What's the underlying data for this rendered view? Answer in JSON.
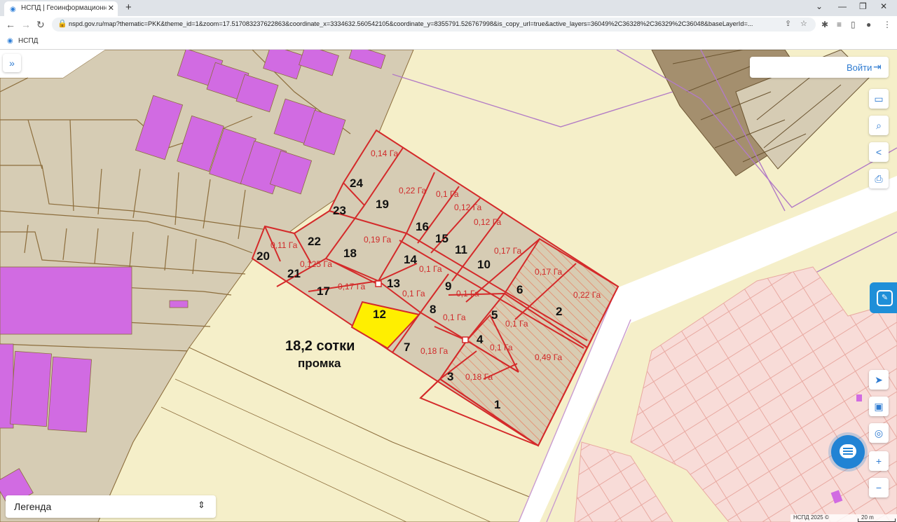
{
  "browser": {
    "tab_title": "НСПД | Геоинформационный п",
    "tab_close": "✕",
    "new_tab": "+",
    "url": "nspd.gov.ru/map?thematic=PKK&theme_id=1&zoom=17.517083237622863&coordinate_x=3334632.560542105&coordinate_y=8355791.526767998&is_copy_url=true&active_layers=36049%2C36328%2C36329%2C36048&baseLayerId=...",
    "bookmark": "НСПД"
  },
  "map": {
    "login_label": "Войти",
    "legend_label": "Легенда",
    "attribution": "НСПД 2025 ©",
    "scale_label": "20 m",
    "lot_title": "18,2 сотки",
    "lot_subtitle": "промка",
    "parcels": [
      {
        "id": "1",
        "area": "0,49 Га"
      },
      {
        "id": "2",
        "area": "0,22 Га"
      },
      {
        "id": "3",
        "area": "0,18 Га"
      },
      {
        "id": "4",
        "area": "0,1 Га"
      },
      {
        "id": "5",
        "area": "0,1 Га"
      },
      {
        "id": "6",
        "area": "0,17 Га"
      },
      {
        "id": "7",
        "area": "0,18 Га"
      },
      {
        "id": "8",
        "area": "0,1 Га"
      },
      {
        "id": "9",
        "area": "0,1 Га"
      },
      {
        "id": "10",
        "area": "0,17 Га"
      },
      {
        "id": "11",
        "area": "0,12 Га"
      },
      {
        "id": "12",
        "area": ""
      },
      {
        "id": "13",
        "area": "0,1 Га"
      },
      {
        "id": "14",
        "area": "0,1 Га"
      },
      {
        "id": "15",
        "area": "0,12 Га"
      },
      {
        "id": "16",
        "area": "0,1 Га"
      },
      {
        "id": "17",
        "area": "0,17 Га"
      },
      {
        "id": "18",
        "area": "0,19 Га"
      },
      {
        "id": "19",
        "area": "0,22 Га"
      },
      {
        "id": "20",
        "area": "0,11 Га"
      },
      {
        "id": "21",
        "area": "0,125 Га"
      },
      {
        "id": "22",
        "area": ""
      },
      {
        "id": "23",
        "area": ""
      },
      {
        "id": "24",
        "area": "0,14 Га"
      }
    ]
  },
  "colors": {
    "selected_parcel": "#ffef00",
    "parcel_border": "#d42a2a",
    "building": "#d16be2",
    "land": "#d6ccb4",
    "brand": "#2e7bd1"
  },
  "icons": {
    "expand": "double-chevron-right-icon",
    "login": "sign-in-icon",
    "ruler": "ruler-icon",
    "search_area": "search-area-icon",
    "share": "share-icon",
    "print": "print-icon",
    "locate": "navigation-arrow-icon",
    "layers": "layers-icon",
    "geo": "geolocation-icon",
    "zoom_in": "plus-icon",
    "zoom_out": "minus-icon",
    "chat": "chat-icon"
  }
}
